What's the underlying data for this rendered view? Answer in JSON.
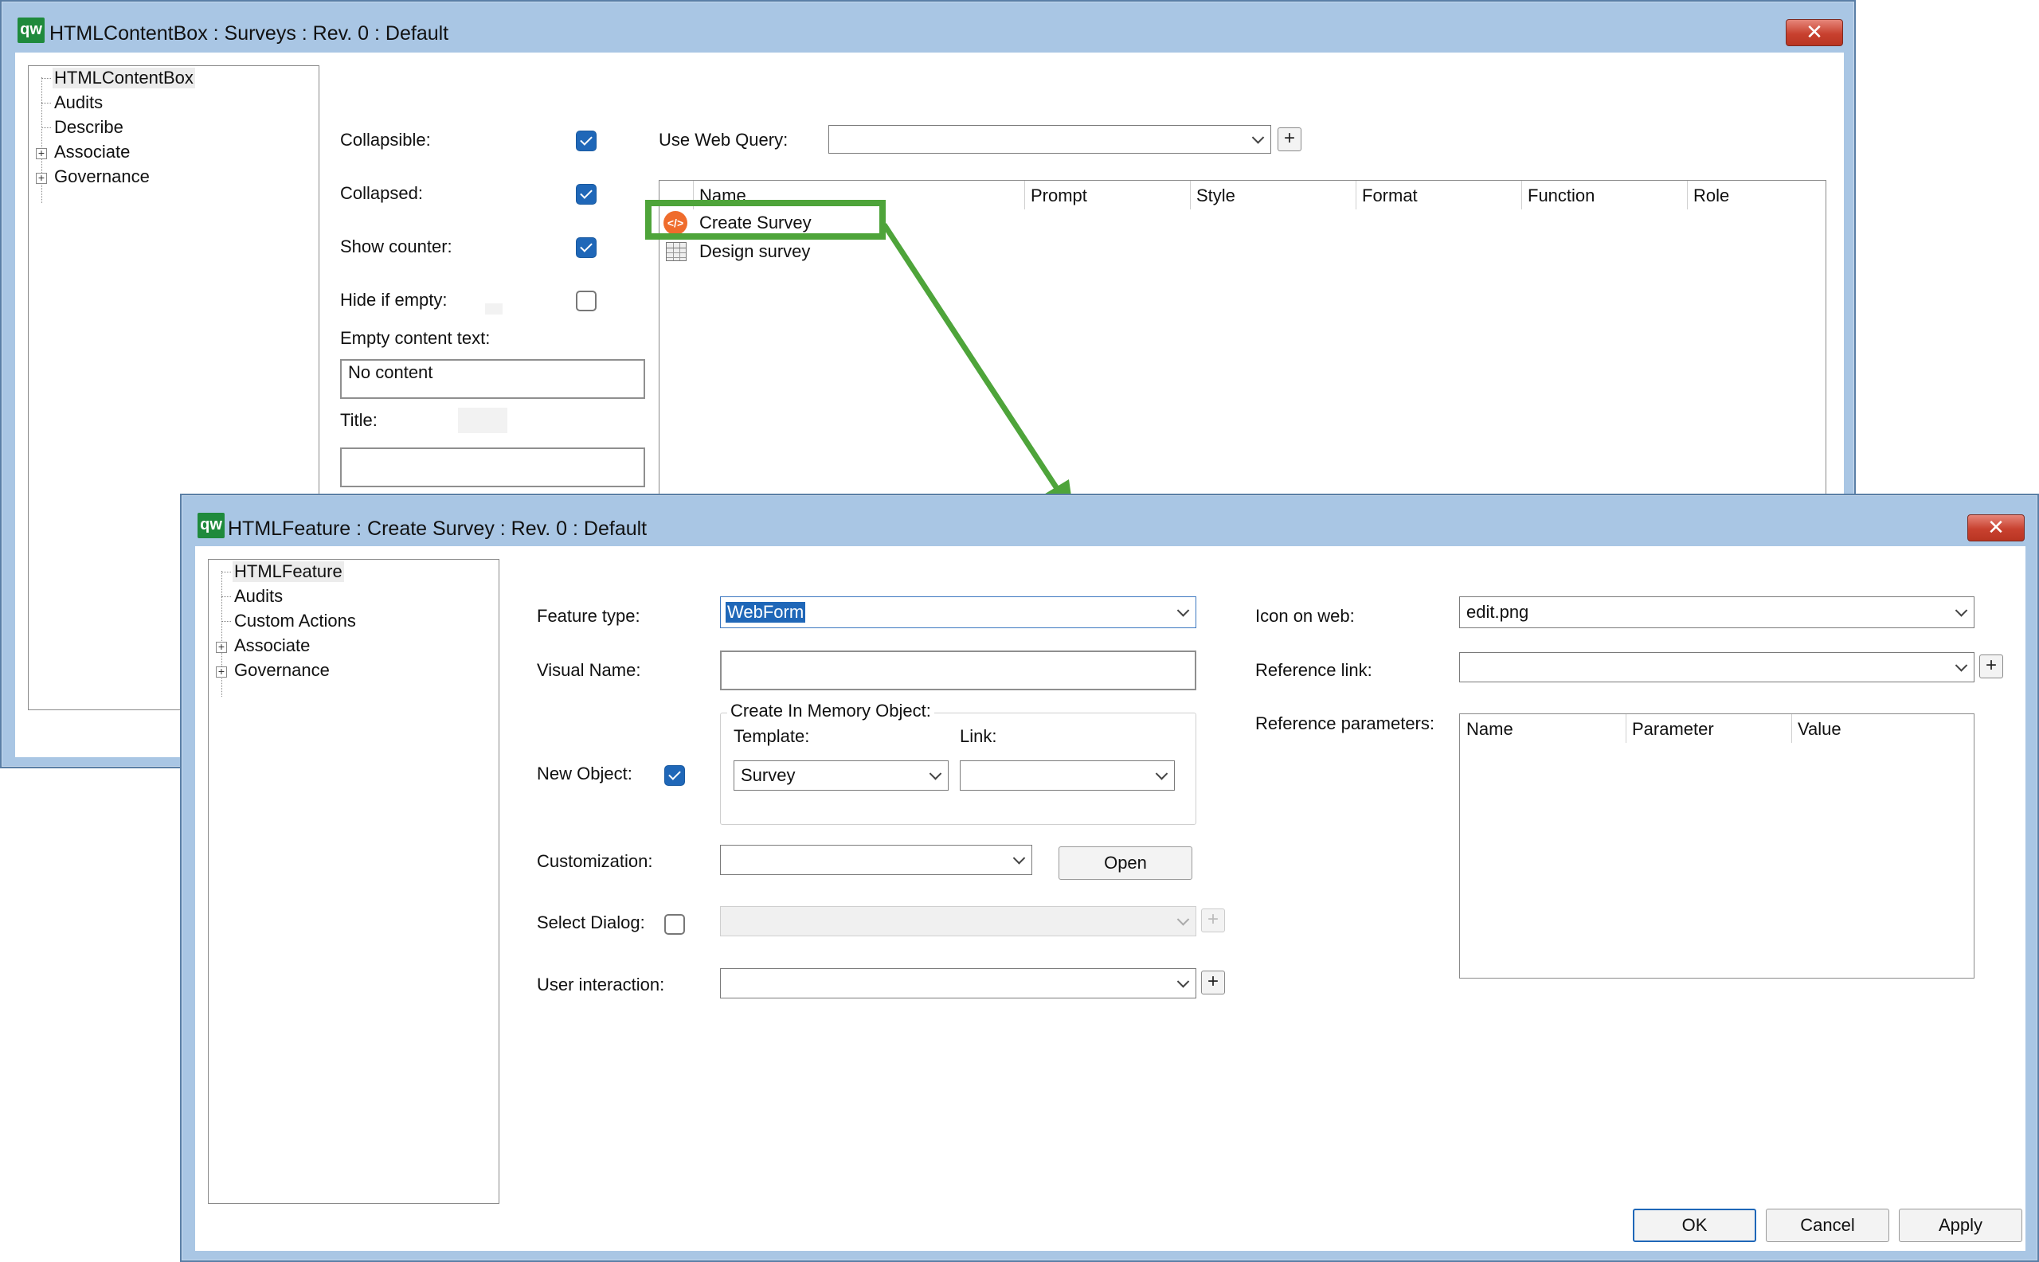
{
  "back_window": {
    "title": "HTMLContentBox : Surveys : Rev. 0  : Default",
    "tree": [
      "HTMLContentBox",
      "Audits",
      "Describe",
      "Associate",
      "Governance"
    ],
    "collapsible_label": "Collapsible:",
    "collapsed_label": "Collapsed:",
    "show_counter_label": "Show counter:",
    "hide_if_empty_label": "Hide if empty:",
    "empty_content_text_label": "Empty content text:",
    "empty_content_text_value": "No content",
    "title_label": "Title:",
    "title_value": "",
    "use_web_query_label": "Use Web Query:",
    "use_web_query_value": "",
    "columns": [
      "Name",
      "Prompt",
      "Style",
      "Format",
      "Function",
      "Role"
    ],
    "rows": [
      {
        "name": "Create Survey",
        "icon": "html-icon"
      },
      {
        "name": "Design survey",
        "icon": "table-icon"
      }
    ],
    "highlight_color": "#4ea43a"
  },
  "front_window": {
    "title": "HTMLFeature : Create Survey : Rev. 0  : Default",
    "tree": [
      "HTMLFeature",
      "Audits",
      "Custom Actions",
      "Associate",
      "Governance"
    ],
    "feature_type_label": "Feature type:",
    "feature_type_value": "WebForm",
    "visual_name_label": "Visual Name:",
    "visual_name_value": "",
    "create_in_memory_object_label": "Create In Memory Object:",
    "template_label": "Template:",
    "template_value": "Survey",
    "link_label": "Link:",
    "link_value": "",
    "new_object_label": "New Object:",
    "customization_label": "Customization:",
    "customization_value": "",
    "open_button": "Open",
    "select_dialog_label": "Select Dialog:",
    "select_dialog_value": "",
    "user_interaction_label": "User interaction:",
    "user_interaction_value": "",
    "icon_on_web_label": "Icon on web:",
    "icon_on_web_value": "edit.png",
    "reference_link_label": "Reference link:",
    "reference_link_value": "",
    "reference_parameters_label": "Reference parameters:",
    "param_columns": [
      "Name",
      "Parameter",
      "Value"
    ],
    "ok_button": "OK",
    "cancel_button": "Cancel",
    "apply_button": "Apply"
  },
  "logo_text": "qw",
  "accent_color": "#1f67b8",
  "close_symbol": "✕",
  "plus_symbol": "+",
  "html_icon_symbol": "</>"
}
